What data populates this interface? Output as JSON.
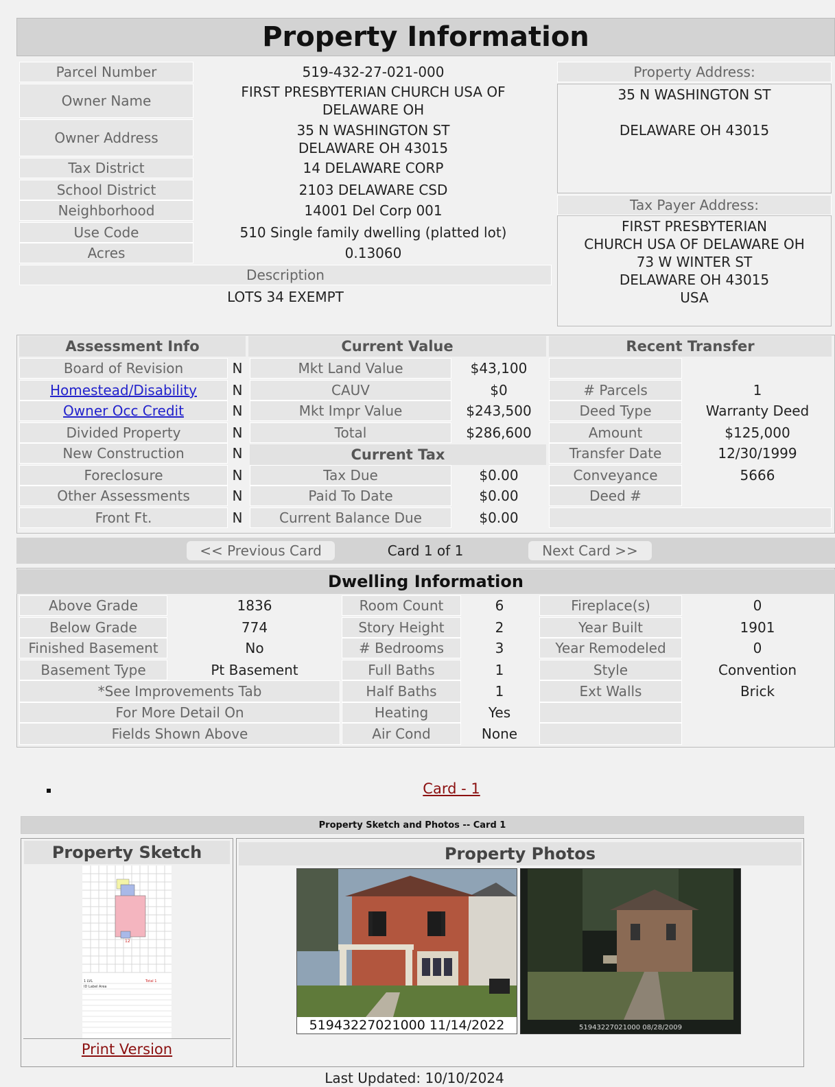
{
  "title": "Property Information",
  "parcel": {
    "labels": [
      "Parcel Number",
      "Owner Name",
      "Owner Address",
      "Tax District",
      "School District",
      "Neighborhood",
      "Use Code",
      "Acres"
    ],
    "parcel_number": "519-432-27-021-000",
    "owner_name_1": "FIRST PRESBYTERIAN CHURCH USA OF",
    "owner_name_2": "DELAWARE OH",
    "owner_address_1": "35 N WASHINGTON ST",
    "owner_address_2": "DELAWARE OH 43015",
    "tax_district": "14 DELAWARE CORP",
    "school_district": "2103 DELAWARE CSD",
    "neighborhood": "14001 Del Corp 001",
    "use_code": "510 Single family dwelling (platted lot)",
    "acres": "0.13060",
    "description_label": "Description",
    "description": "LOTS 34 EXEMPT"
  },
  "property_address": {
    "label": "Property Address:",
    "line1": "35 N WASHINGTON ST",
    "line2": "DELAWARE OH 43015"
  },
  "tax_payer_address": {
    "label": "Tax Payer Address:",
    "line1": "FIRST PRESBYTERIAN",
    "line2": "CHURCH USA OF DELAWARE OH",
    "line3": "73 W WINTER ST",
    "line4": "DELAWARE OH 43015",
    "line5": "USA"
  },
  "assessment": {
    "header": "Assessment Info",
    "rows": [
      {
        "label": "Board of Revision",
        "value": "N"
      },
      {
        "label": "Homestead/Disability",
        "value": "N"
      },
      {
        "label": "Owner Occ Credit",
        "value": "N"
      },
      {
        "label": "Divided Property",
        "value": "N"
      },
      {
        "label": "New Construction",
        "value": "N"
      },
      {
        "label": "Foreclosure",
        "value": "N"
      },
      {
        "label": "Other Assessments",
        "value": "N"
      },
      {
        "label": "Front Ft.",
        "value": "N"
      }
    ]
  },
  "current_value": {
    "header": "Current Value",
    "rows": [
      {
        "label": "Mkt Land Value",
        "value": "$43,100"
      },
      {
        "label": "CAUV",
        "value": "$0"
      },
      {
        "label": "Mkt Impr Value",
        "value": "$243,500"
      },
      {
        "label": "Total",
        "value": "$286,600"
      }
    ]
  },
  "current_tax": {
    "header": "Current Tax",
    "rows": [
      {
        "label": "Tax Due",
        "value": "$0.00"
      },
      {
        "label": "Paid To Date",
        "value": "$0.00"
      },
      {
        "label": "Current Balance Due",
        "value": "$0.00"
      }
    ]
  },
  "recent_transfer": {
    "header": "Recent Transfer",
    "rows": [
      {
        "label": "# Parcels",
        "value": "1"
      },
      {
        "label": "Deed Type",
        "value": "Warranty Deed"
      },
      {
        "label": "Amount",
        "value": "$125,000"
      },
      {
        "label": "Transfer Date",
        "value": "12/30/1999"
      },
      {
        "label": "Conveyance",
        "value": "5666"
      },
      {
        "label": "Deed #",
        "value": ""
      }
    ]
  },
  "card_nav": {
    "prev": "<< Previous Card",
    "status": "Card 1 of 1",
    "next": "Next Card >>"
  },
  "dwelling": {
    "header": "Dwelling Information",
    "col1": [
      {
        "label": "Above Grade",
        "value": "1836"
      },
      {
        "label": "Below Grade",
        "value": "774"
      },
      {
        "label": "Finished Basement",
        "value": "No"
      },
      {
        "label": "Basement Type",
        "value": "Pt Basement"
      }
    ],
    "note1": "*See Improvements Tab",
    "note2": "For More Detail On",
    "note3": "Fields Shown Above",
    "col2": [
      {
        "label": "Room Count",
        "value": "6"
      },
      {
        "label": "Story Height",
        "value": "2"
      },
      {
        "label": "# Bedrooms",
        "value": "3"
      },
      {
        "label": "Full Baths",
        "value": "1"
      },
      {
        "label": "Half Baths",
        "value": "1"
      },
      {
        "label": "Heating",
        "value": "Yes"
      },
      {
        "label": "Air Cond",
        "value": "None"
      }
    ],
    "col3": [
      {
        "label": "Fireplace(s)",
        "value": "0"
      },
      {
        "label": "Year Built",
        "value": "1901"
      },
      {
        "label": "Year Remodeled",
        "value": "0"
      },
      {
        "label": "Style",
        "value": "Convention"
      },
      {
        "label": "Ext Walls",
        "value": "Brick"
      }
    ]
  },
  "card_link": "Card - 1",
  "sketch_section": {
    "title": "Property Sketch and Photos -- Card 1",
    "sketch_header": "Property Sketch",
    "photos_header": "Property Photos",
    "print_version": "Print Version",
    "photo1_caption": "51943227021000 11/14/2022",
    "photo2_caption": "51943227021000 08/28/2009"
  },
  "last_updated": "Last Updated: 10/10/2024"
}
